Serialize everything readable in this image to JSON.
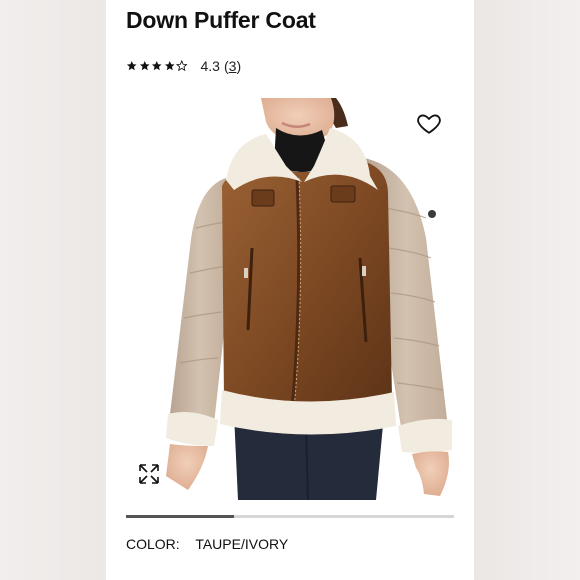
{
  "product": {
    "title": "Down Puffer Coat",
    "rating_value": "4.3",
    "rating_count": "3",
    "rating_stars": 4.3
  },
  "gallery": {
    "image_alt": "Model wearing brown faux-leather shearling-trimmed jacket with taupe puffer sleeves",
    "wishlist_icon": "heart-outline-icon",
    "expand_icon": "expand-arrows-icon",
    "progress": 0.33
  },
  "color": {
    "label": "COLOR:",
    "value": "TAUPE/IVORY"
  }
}
